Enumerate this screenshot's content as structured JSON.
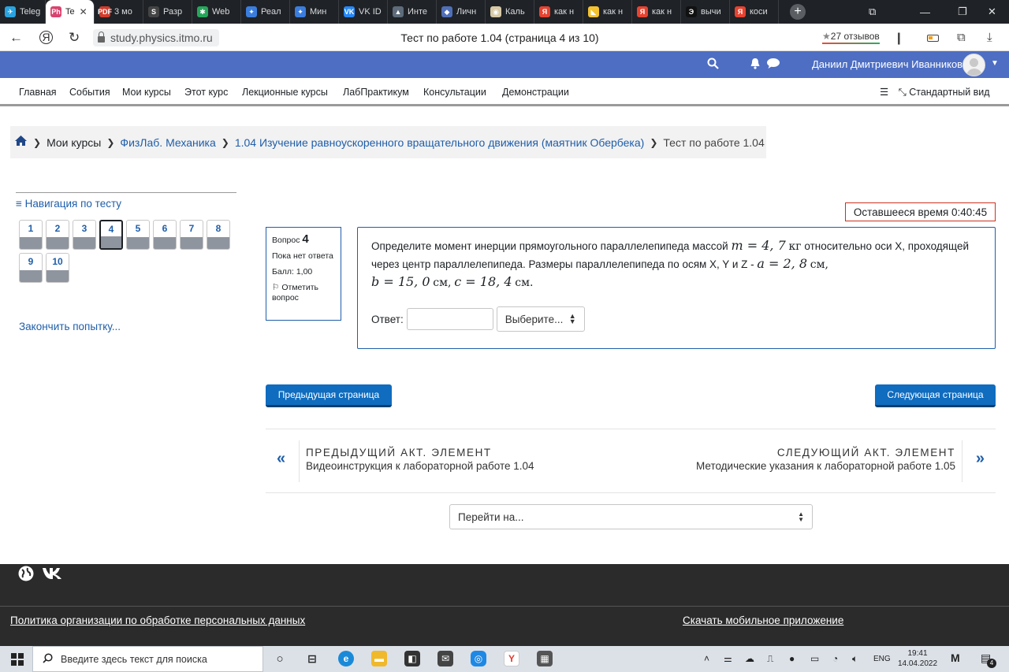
{
  "browser": {
    "tabs": [
      {
        "label": "Teleg",
        "color": "#2aa3df",
        "glyph": "✈"
      },
      {
        "label": "Te",
        "color": "#d9436f",
        "glyph": "Ph",
        "active": true
      },
      {
        "label": "3 мо",
        "color": "#d43c2c",
        "glyph": "PDF"
      },
      {
        "label": "Разр",
        "color": "#444",
        "glyph": "S"
      },
      {
        "label": "Web",
        "color": "#26a65b",
        "glyph": "✱"
      },
      {
        "label": "Реал",
        "color": "#3b7ddd",
        "glyph": "✦"
      },
      {
        "label": "Мин",
        "color": "#3b7ddd",
        "glyph": "✦"
      },
      {
        "label": "VK ID",
        "color": "#2787f5",
        "glyph": "VK"
      },
      {
        "label": "Инте",
        "color": "#5d6b7a",
        "glyph": "▲"
      },
      {
        "label": "Личн",
        "color": "#4f6fb8",
        "glyph": "◆"
      },
      {
        "label": "Каль",
        "color": "#d8c9a6",
        "glyph": "◉"
      },
      {
        "label": "как н",
        "color": "#e64331",
        "glyph": "Я"
      },
      {
        "label": "как н",
        "color": "#f2c230",
        "glyph": "◣"
      },
      {
        "label": "как н",
        "color": "#e64331",
        "glyph": "Я"
      },
      {
        "label": "вычи",
        "color": "#111",
        "glyph": "Э"
      },
      {
        "label": "коси",
        "color": "#e64331",
        "glyph": "Я"
      }
    ],
    "new_tab": "+",
    "url": "study.physics.itmo.ru",
    "page_title": "Тест по работе 1.04 (страница 4 из 10)",
    "reviews": "27 отзывов"
  },
  "header": {
    "user_name": "Даниил Дмитриевич Иванников"
  },
  "subnav": {
    "items": [
      "Главная",
      "События",
      "Мои курсы",
      "Этот курс",
      "Лекционные курсы",
      "ЛабПрактикум",
      "Консультации",
      "Демонстрации"
    ],
    "standard_view": "Стандартный вид"
  },
  "breadcrumb": {
    "items": [
      "Мои курсы",
      "ФизЛаб. Механика",
      "1.04 Изучение равноускоренного вращательного движения (маятник Обербека)",
      "Тест по работе 1.04"
    ]
  },
  "quiz_nav": {
    "title": "Навигация по тесту",
    "buttons": [
      "1",
      "2",
      "3",
      "4",
      "5",
      "6",
      "7",
      "8",
      "9",
      "10"
    ],
    "current": "4",
    "finish": "Закончить попытку..."
  },
  "timer": "Оставшееся время 0:40:45",
  "question": {
    "label": "Вопрос",
    "number": "4",
    "status": "Пока нет ответа",
    "score": "Балл: 1,00",
    "flag": "Отметить вопрос",
    "text_part1": "Определите момент инерции прямоугольного параллелепипеда массой",
    "mass_math": "m = 4, 7",
    "mass_unit": "кг",
    "text_part2": "относительно оси X, проходящей через центр параллелепипеда. Размеры параллелепипеда по осям X, Y и Z -",
    "a_math": "a = 2, 8",
    "a_unit": "см,",
    "b_math": "b = 15, 0",
    "b_unit": "см,",
    "c_math": "c = 18, 4",
    "c_unit": "см.",
    "answer_label": "Ответ:",
    "answer_value": "",
    "unit_select": "Выберите..."
  },
  "buttons": {
    "prev_page": "Предыдущая страница",
    "next_page": "Следующая страница"
  },
  "activity_nav": {
    "prev_heading": "ПРЕДЫДУЩИЙ АКТ. ЭЛЕМЕНТ",
    "prev_link": "Видеоинструкция к лабораторной работе 1.04",
    "next_heading": "СЛЕДУЮЩИЙ АКТ. ЭЛЕМЕНТ",
    "next_link": "Методические указания к лабораторной работе 1.05",
    "jump_to": "Перейти на..."
  },
  "footer": {
    "privacy": "Политика организации по обработке персональных данных",
    "mobile_app": "Скачать мобильное приложение"
  },
  "taskbar": {
    "search_placeholder": "Введите здесь текст для поиска",
    "lang": "ENG",
    "time": "19:41",
    "date": "14.04.2022",
    "notifications": "4"
  }
}
